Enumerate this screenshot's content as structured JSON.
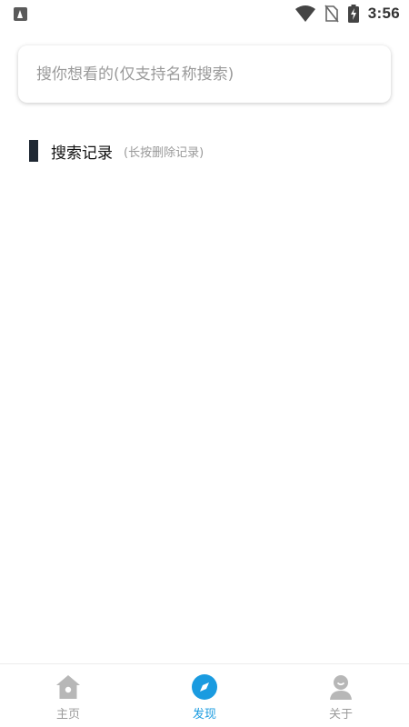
{
  "status_bar": {
    "time": "3:56",
    "icons": [
      "notification-a-icon",
      "wifi-icon",
      "no-sim-icon",
      "battery-charging-icon"
    ]
  },
  "search": {
    "placeholder": "搜你想看的(仅支持名称搜索)",
    "value": ""
  },
  "history": {
    "title": "搜索记录",
    "hint": "(长按删除记录)",
    "items": []
  },
  "bottom_nav": {
    "items": [
      {
        "label": "主页",
        "icon": "home-icon",
        "active": false
      },
      {
        "label": "发现",
        "icon": "compass-icon",
        "active": true
      },
      {
        "label": "关于",
        "icon": "person-icon",
        "active": false
      }
    ]
  },
  "colors": {
    "accent": "#1a9be0",
    "inactive": "#b7b7b7",
    "history_bar": "#1f2833"
  }
}
